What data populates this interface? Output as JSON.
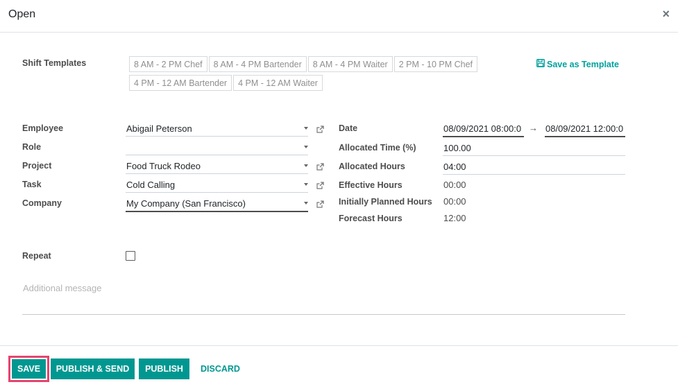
{
  "dialog": {
    "title": "Open",
    "close_icon": "close-icon"
  },
  "shift_templates": {
    "label": "Shift Templates",
    "items": [
      "8 AM - 2 PM Chef",
      "8 AM - 4 PM Bartender",
      "8 AM - 4 PM Waiter",
      "2 PM - 10 PM Chef",
      "4 PM - 12 AM Bartender",
      "4 PM - 12 AM Waiter"
    ],
    "save_as_template": "Save as Template",
    "save_icon": "floppy-disk-icon"
  },
  "left_fields": {
    "employee": {
      "label": "Employee",
      "value": "Abigail Peterson"
    },
    "role": {
      "label": "Role",
      "value": ""
    },
    "project": {
      "label": "Project",
      "value": "Food Truck Rodeo"
    },
    "task": {
      "label": "Task",
      "value": "Cold Calling"
    },
    "company": {
      "label": "Company",
      "value": "My Company (San Francisco)"
    }
  },
  "right_fields": {
    "date": {
      "label": "Date",
      "start": "08/09/2021 08:00:0",
      "end": "08/09/2021 12:00:0",
      "separator": "→"
    },
    "allocated_time": {
      "label": "Allocated Time (%)",
      "value": "100.00"
    },
    "allocated_hours": {
      "label": "Allocated Hours",
      "value": "04:00"
    },
    "effective_hours": {
      "label": "Effective Hours",
      "value": "00:00"
    },
    "initially_planned_hours": {
      "label": "Initially Planned Hours",
      "value": "00:00"
    },
    "forecast_hours": {
      "label": "Forecast Hours",
      "value": "12:00"
    }
  },
  "repeat": {
    "label": "Repeat",
    "checked": false
  },
  "message": {
    "placeholder": "Additional message"
  },
  "footer": {
    "save": "SAVE",
    "publish_send": "PUBLISH & SEND",
    "publish": "PUBLISH",
    "discard": "DISCARD"
  },
  "colors": {
    "accent": "#019791",
    "highlight_border": "#e8436e"
  }
}
